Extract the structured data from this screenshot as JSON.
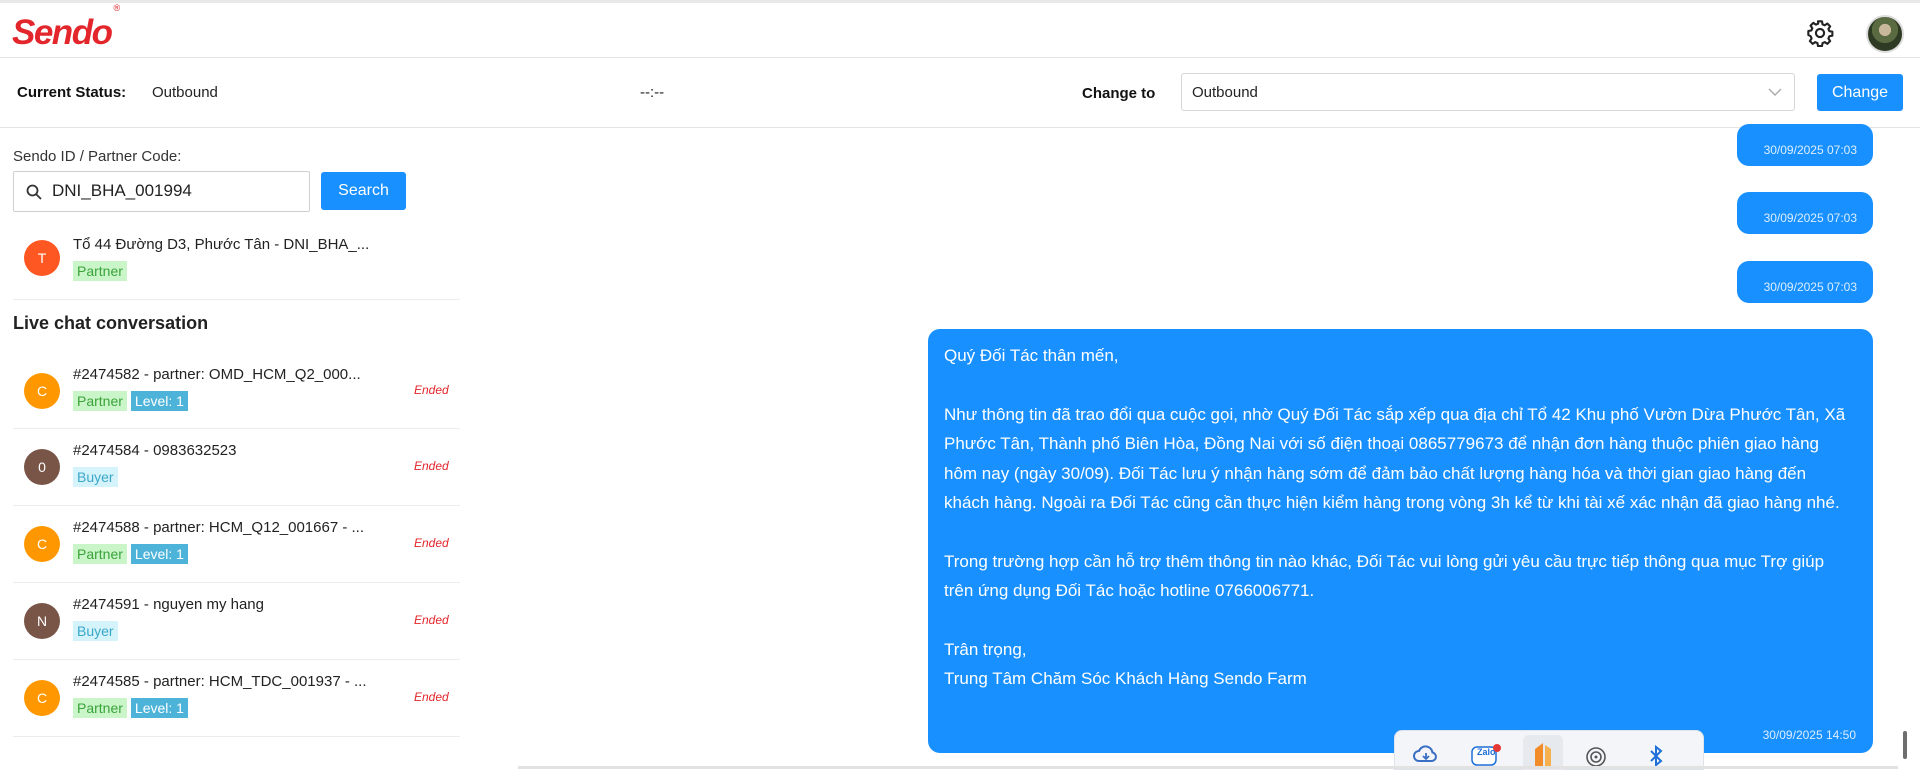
{
  "header": {
    "logo": "Sendo",
    "logo_mark": "®",
    "settings_icon": "gear-icon",
    "avatar_icon": "user-avatar"
  },
  "status_bar": {
    "current_label": "Current Status:",
    "current_value": "Outbound",
    "timer": "--:--",
    "change_label": "Change to",
    "select_value": "Outbound",
    "change_button": "Change"
  },
  "search": {
    "label": "Sendo ID / Partner Code:",
    "value": "DNI_BHA_001994",
    "button": "Search"
  },
  "result": {
    "avatar_letter": "T",
    "avatar_color": "#ff5722",
    "title": "Tổ 44 Đường D3, Phước Tân - DNI_BHA_...",
    "tag": "Partner"
  },
  "live_chat": {
    "title": "Live chat conversation",
    "items": [
      {
        "letter": "C",
        "color": "#ff9800",
        "title": "#2474582 - partner: OMD_HCM_Q2_000...",
        "tag": "Partner",
        "level": "Level: 1",
        "status": "Ended"
      },
      {
        "letter": "0",
        "color": "#795548",
        "title": "#2474584 - 0983632523",
        "tag": "Buyer",
        "level": "",
        "status": "Ended"
      },
      {
        "letter": "C",
        "color": "#ff9800",
        "title": "#2474588 - partner: HCM_Q12_001667 - ...",
        "tag": "Partner",
        "level": "Level: 1",
        "status": "Ended"
      },
      {
        "letter": "N",
        "color": "#795548",
        "title": "#2474591 - nguyen my hang",
        "tag": "Buyer",
        "level": "",
        "status": "Ended"
      },
      {
        "letter": "C",
        "color": "#ff9800",
        "title": "#2474585 - partner: HCM_TDC_001937 - ...",
        "tag": "Partner",
        "level": "Level: 1",
        "status": "Ended"
      }
    ]
  },
  "chat": {
    "small_messages": [
      {
        "timestamp": "30/09/2025 07:03"
      },
      {
        "timestamp": "30/09/2025 07:03"
      },
      {
        "timestamp": "30/09/2025 07:03"
      }
    ],
    "big_message": {
      "text": "Quý Đối Tác thân mến,\n\nNhư thông tin đã trao đổi qua cuộc gọi, nhờ Quý Đối Tác sắp xếp qua địa chỉ Tổ 42 Khu phố Vườn Dừa Phước Tân, Xã Phước Tân, Thành phố Biên Hòa, Đồng Nai với số điện thoại 0865779673 để nhận đơn hàng thuộc phiên giao hàng hôm nay (ngày 30/09). Đối Tác lưu ý nhận hàng sớm để đảm bảo chất lượng hàng hóa và thời gian giao hàng đến khách hàng. Ngoài ra Đối Tác cũng cần thực hiện kiểm hàng trong vòng 3h kể từ khi tài xế xác nhận đã giao hàng nhé.\n\nTrong trường hợp cần hỗ trợ thêm thông tin nào khác, Đối Tác vui lòng gửi yêu cầu trực tiếp thông qua mục Trợ giúp trên ứng dụng Đối Tác hoặc hotline 0766006771.\n\nTrân trọng,\nTrung Tâm Chăm Sóc Khách Hàng Sendo Farm",
      "timestamp": "30/09/2025 14:50"
    }
  },
  "tray": {
    "icons": [
      "cloud-sync-icon",
      "zalo-icon",
      "app-icon",
      "fingerprint-icon",
      "bluetooth-icon"
    ],
    "zalo_label": "Zalo"
  },
  "colors": {
    "brand": "#e3262b",
    "accent": "#1890ff",
    "ended": "#e3262b"
  }
}
